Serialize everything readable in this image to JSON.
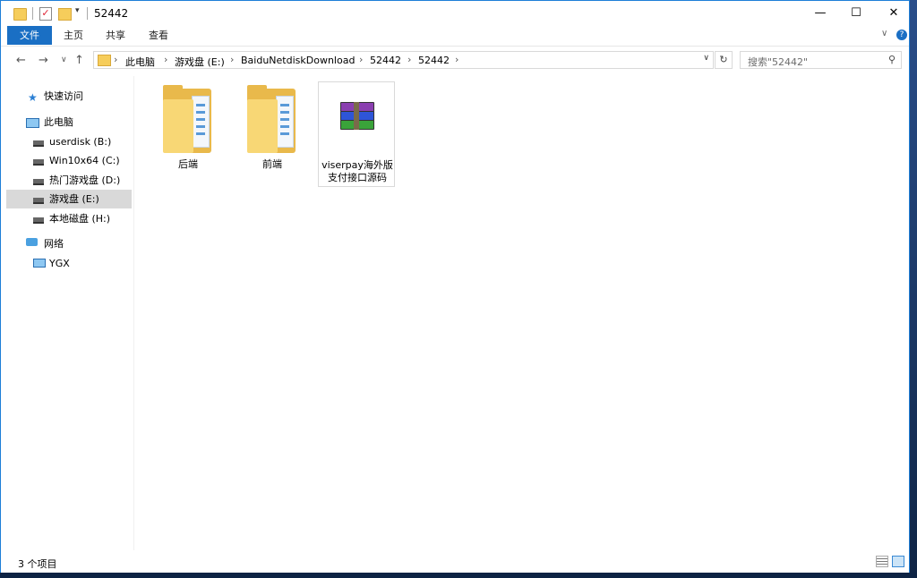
{
  "window": {
    "title": "52442"
  },
  "ribbon": {
    "file": "文件",
    "home": "主页",
    "share": "共享",
    "view": "查看"
  },
  "address": {
    "crumbs": [
      "此电脑",
      "游戏盘 (E:)",
      "BaiduNetdiskDownload",
      "52442",
      "52442"
    ]
  },
  "search": {
    "placeholder": "搜索\"52442\""
  },
  "navpane": {
    "items": [
      {
        "label": "快速访问",
        "icon": "star-icon"
      },
      {
        "label": "此电脑",
        "icon": "computer-icon"
      },
      {
        "label": "userdisk (B:)",
        "icon": "drive-icon"
      },
      {
        "label": "Win10x64 (C:)",
        "icon": "system-drive-icon"
      },
      {
        "label": "热门游戏盘 (D:)",
        "icon": "drive-icon"
      },
      {
        "label": "游戏盘 (E:)",
        "icon": "drive-icon",
        "selected": true
      },
      {
        "label": "本地磁盘 (H:)",
        "icon": "drive-icon"
      },
      {
        "label": "网络",
        "icon": "network-icon"
      },
      {
        "label": "YGX",
        "icon": "monitor-icon"
      }
    ]
  },
  "files": [
    {
      "label": "后端",
      "type": "folder"
    },
    {
      "label": "前端",
      "type": "folder"
    },
    {
      "label": "viserpay海外版支付接口源码",
      "type": "rar-archive"
    }
  ],
  "status": {
    "count": "3 个项目"
  },
  "colors": {
    "accent": "#1a6fc4",
    "folder": "#f8d775",
    "selected": "#d9d9d9"
  }
}
